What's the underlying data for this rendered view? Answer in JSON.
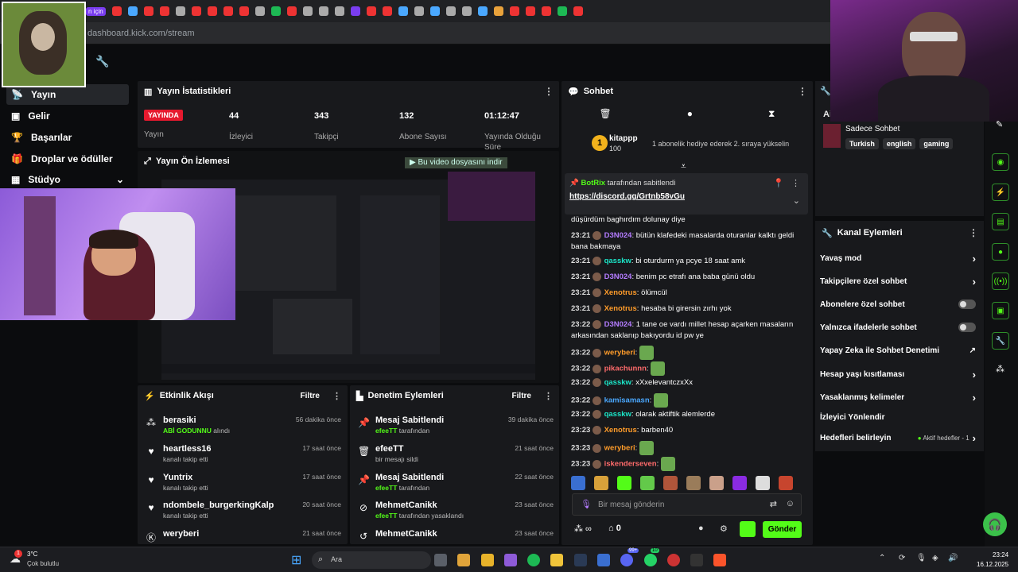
{
  "browser": {
    "url": "dashboard.kick.com/stream",
    "tab_fragment": "n için"
  },
  "sidebar": {
    "items": [
      {
        "label": "Yayın",
        "icon": "broadcast-icon"
      },
      {
        "label": "Gelir",
        "icon": "money-icon"
      },
      {
        "label": "Başarılar",
        "icon": "trophy-icon"
      },
      {
        "label": "Droplar ve ödüller",
        "icon": "gift-icon"
      },
      {
        "label": "Stüdyo",
        "icon": "studio-icon"
      }
    ]
  },
  "stats": {
    "title": "Yayın İstatistikleri",
    "live_badge": "YAYINDA",
    "live_label": "Yayın",
    "items": [
      {
        "value": "44",
        "label": "İzleyici"
      },
      {
        "value": "343",
        "label": "Takipçi"
      },
      {
        "value": "132",
        "label": "Abone Sayısı"
      },
      {
        "value": "01:12:47",
        "label": "Yayında Olduğu Süre"
      }
    ]
  },
  "preview": {
    "title": "Yayın Ön İzlemesi",
    "download_hint": "Bu video dosyasını indir"
  },
  "activity": {
    "title": "Etkinlik Akışı",
    "filter": "Filtre",
    "items": [
      {
        "name": "berasiki",
        "sub_highlight": "ABİ GODUNNU",
        "sub": "alındı",
        "time": "56 dakika önce",
        "icon": "gift-sub-icon"
      },
      {
        "name": "heartless16",
        "sub_highlight": "",
        "sub": "kanalı takip etti",
        "time": "17 saat önce",
        "icon": "heart-icon"
      },
      {
        "name": "Yuntrix",
        "sub_highlight": "",
        "sub": "kanalı takip etti",
        "time": "17 saat önce",
        "icon": "heart-icon"
      },
      {
        "name": "ndombele_burgerkingKalp",
        "sub_highlight": "",
        "sub": "kanalı takip etti",
        "time": "20 saat önce",
        "icon": "heart-icon"
      },
      {
        "name": "weryberi",
        "sub_highlight": "",
        "sub": "",
        "time": "21 saat önce",
        "icon": "kick-icon"
      }
    ]
  },
  "moderation": {
    "title": "Denetim Eylemleri",
    "filter": "Filtre",
    "items": [
      {
        "name": "Mesaj Sabitlendi",
        "sub_highlight": "efeeTT",
        "sub": "tarafından",
        "time": "39 dakika önce",
        "icon": "pin-icon"
      },
      {
        "name": "efeeTT",
        "sub_highlight": "",
        "sub": "bir mesajı sildi",
        "time": "21 saat önce",
        "icon": "trash-icon"
      },
      {
        "name": "Mesaj Sabitlendi",
        "sub_highlight": "efeeTT",
        "sub": "tarafından",
        "time": "22 saat önce",
        "icon": "pin-icon"
      },
      {
        "name": "MehmetCanikk",
        "sub_highlight": "efeeTT",
        "sub": "tarafından yasaklandı",
        "time": "23 saat önce",
        "icon": "ban-icon"
      },
      {
        "name": "MehmetCanikk",
        "sub_highlight": "",
        "sub": "",
        "time": "23 saat önce",
        "icon": "unban-icon"
      }
    ]
  },
  "chat": {
    "title": "Sohbet",
    "top_gifter": {
      "name": "kitappp",
      "amount": "100",
      "rank": "1",
      "notice": "1 abonelik hediye ederek 2. sıraya yükselin"
    },
    "pinned": {
      "author": "BotRix",
      "suffix": "tarafından sabitlendi",
      "link": "https://discord.gg/Grtnb58vGu"
    },
    "messages": [
      {
        "time": "",
        "user": "",
        "color": "#fff",
        "text": "düşürdüm baghırdım dolunay diye"
      },
      {
        "time": "23:21",
        "user": "D3N024",
        "color": "#b47cff",
        "text": "bütün klafedeki masalarda oturanlar kalktı geldi bana bakmaya"
      },
      {
        "time": "23:21",
        "user": "qasskw",
        "color": "#1be6c8",
        "text": "bi oturdurm ya pcye 18 saat amk"
      },
      {
        "time": "23:21",
        "user": "D3N024",
        "color": "#b47cff",
        "text": "benim pc etrafı ana baba günü oldu"
      },
      {
        "time": "23:21",
        "user": "Xenotrus",
        "color": "#ff9c2a",
        "text": "ölümcül"
      },
      {
        "time": "23:21",
        "user": "Xenotrus",
        "color": "#ff9c2a",
        "text": "hesaba bi girersin zırhı yok"
      },
      {
        "time": "23:22",
        "user": "D3N024",
        "color": "#b47cff",
        "text": "1 tane oe vardı millet hesap açarken masaların arkasından saklanıp bakıyordu id pw ye"
      },
      {
        "time": "23:22",
        "user": "weryberi",
        "color": "#ff9c2a",
        "text": ""
      },
      {
        "time": "23:22",
        "user": "pikachunnn",
        "color": "#ff6b6b",
        "text": ""
      },
      {
        "time": "23:22",
        "user": "qasskw",
        "color": "#1be6c8",
        "text": "xXxelevantczxXx"
      },
      {
        "time": "23:22",
        "user": "kamisamasn",
        "color": "#4aa8ff",
        "text": ""
      },
      {
        "time": "23:22",
        "user": "qasskw",
        "color": "#1be6c8",
        "text": "olarak aktiftik alemlerde"
      },
      {
        "time": "23:23",
        "user": "Xenotrus",
        "color": "#ff9c2a",
        "text": "barben40"
      },
      {
        "time": "23:23",
        "user": "weryberi",
        "color": "#ff9c2a",
        "text": ""
      },
      {
        "time": "23:23",
        "user": "iskenderseven",
        "color": "#ff6b6b",
        "text": ""
      }
    ],
    "input_placeholder": "Bir mesaj gönderin",
    "points": "0",
    "send": "Gönder"
  },
  "channel_info": {
    "title_partial": "Ai",
    "stream_title": "Sadece Sohbet",
    "tags": [
      "Turkish",
      "english",
      "gaming"
    ]
  },
  "channel_actions": {
    "title": "Kanal Eylemleri",
    "items": [
      {
        "label": "Yavaş mod",
        "control": "chevron"
      },
      {
        "label": "Takipçilere özel sohbet",
        "control": "chevron"
      },
      {
        "label": "Abonelere özel sohbet",
        "control": "toggle"
      },
      {
        "label": "Yalnızca ifadelerle sohbet",
        "control": "toggle"
      },
      {
        "label": "Yapay Zeka ile Sohbet Denetimi",
        "control": "external"
      },
      {
        "label": "Hesap yaşı kısıtlaması",
        "control": "chevron"
      },
      {
        "label": "Yasaklanmış kelimeler",
        "control": "chevron"
      },
      {
        "label": "İzleyici Yönlendir",
        "control": "none"
      },
      {
        "label": "Hedefleri belirleyin",
        "control": "chevron"
      }
    ],
    "goals_status": "Aktif hedefler - 1"
  },
  "taskbar": {
    "weather_temp": "3°C",
    "weather_desc": "Çok bulutlu",
    "weather_badge": "1",
    "search": "Ara",
    "time": "23:24",
    "date": "16.12.2025",
    "badge_a": "99+",
    "badge_b": "10"
  },
  "colors": {
    "kick_green": "#53fc18",
    "panel_bg": "#18191c",
    "live_red": "#e6192e"
  }
}
